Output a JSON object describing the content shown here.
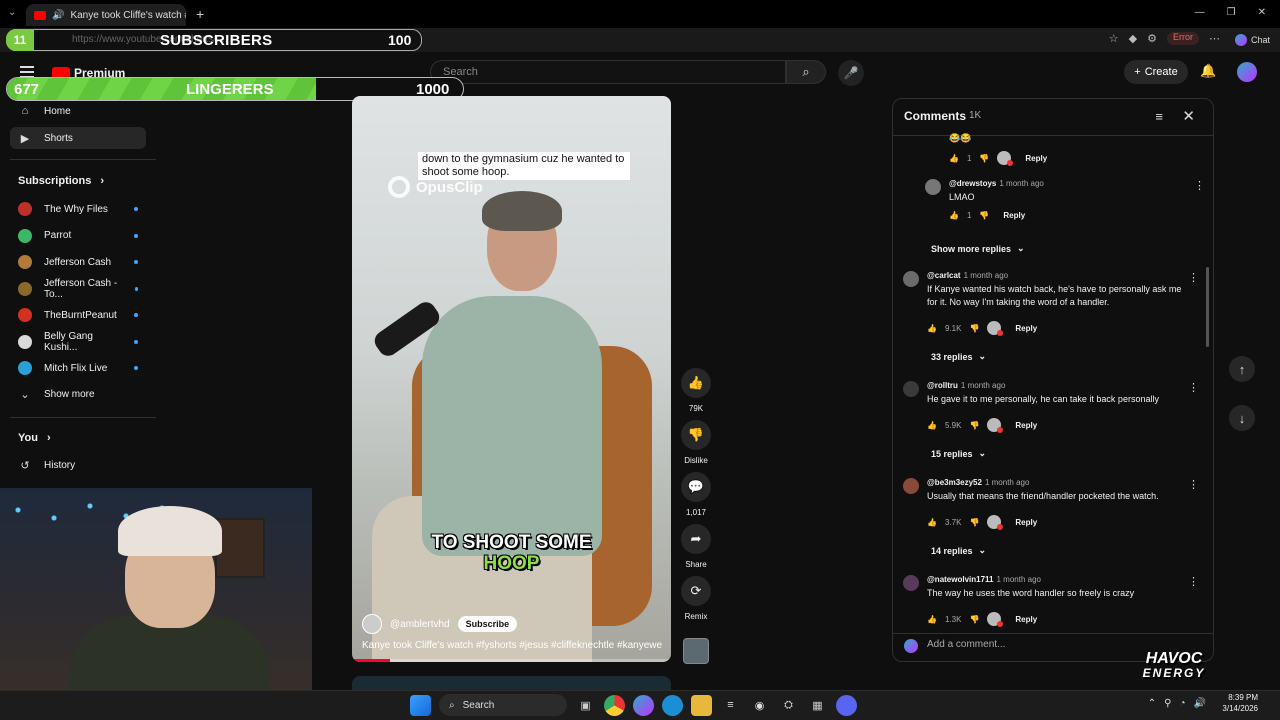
{
  "browser": {
    "tab_title": "Kanye took Cliffe's watch #fys",
    "new_tab_icon": "+",
    "url": "https://www.youtube.com/shorts/...",
    "error_label": "Error",
    "chat_label": "Chat"
  },
  "overlays": {
    "subscribers": {
      "count": "11",
      "label": "SUBSCRIBERS",
      "goal": "100",
      "progress": 0.11
    },
    "lingerers": {
      "count": "677",
      "label": "LINGERERS",
      "goal": "1000",
      "progress": 0.677
    }
  },
  "header": {
    "logo": "Premium",
    "search_placeholder": "Search",
    "create_label": "Create"
  },
  "sidebar": {
    "home": "Home",
    "shorts": "Shorts",
    "subscriptions_heading": "Subscriptions",
    "subscriptions": [
      {
        "name": "The Why Files",
        "color": "#c0302a"
      },
      {
        "name": "Parrot",
        "color": "#3ab86a"
      },
      {
        "name": "Jefferson Cash",
        "color": "#b07a3a"
      },
      {
        "name": "Jefferson Cash - To...",
        "color": "#8a6a2a"
      },
      {
        "name": "TheBurntPeanut",
        "color": "#d4301e"
      },
      {
        "name": "Belly Gang Kushi...",
        "color": "#d9d9d9"
      },
      {
        "name": "Mitch Flix Live",
        "color": "#2aa0d8"
      }
    ],
    "show_more": "Show more",
    "you_heading": "You",
    "history": "History"
  },
  "video": {
    "caption_top": "down to the gymnasium cuz he wanted to shoot some hoop.",
    "watermark": "OpusClip",
    "caption_big_line1": "TO SHOOT SOME",
    "caption_big_line2": "HOOP",
    "channel": "@amblertvhd",
    "subscribe": "Subscribe",
    "title": "Kanye took Cliffe's watch #fyshorts #jesus #cliffeknechtle #kanyewes...",
    "progress": 0.12
  },
  "actions": {
    "likes": "79K",
    "dislike": "Dislike",
    "comments": "1,017",
    "share": "Share",
    "remix": "Remix"
  },
  "comments": {
    "title": "Comments",
    "count": "1K",
    "show_more_replies": "Show more replies",
    "add_placeholder": "Add a comment...",
    "reply_label": "Reply",
    "top_reply": {
      "likes": "1"
    },
    "nested_reply": {
      "handle": "@drewstoys",
      "time": "1 month ago",
      "text": "LMAO",
      "likes": "1"
    },
    "items": [
      {
        "handle": "@carlcat",
        "time": "1 month ago",
        "text": "If Kanye wanted his watch back, he's have to personally ask me for it. No way I'm taking the word of a handler.",
        "likes": "9.1K",
        "replies": "33 replies",
        "color": "#6b6b6b"
      },
      {
        "handle": "@rolltru",
        "time": "1 month ago",
        "text": "He gave it to me personally, he can take it back personally",
        "likes": "5.9K",
        "replies": "15 replies",
        "color": "#3a3a3a"
      },
      {
        "handle": "@be3m3ezy52",
        "time": "1 month ago",
        "text": "Usually that means the friend/handler pocketed the watch.",
        "likes": "3.7K",
        "replies": "14 replies",
        "color": "#8a4a3a"
      },
      {
        "handle": "@natewolvin1711",
        "time": "1 month ago",
        "text": "The way he uses the word handler so freely is crazy",
        "likes": "1.3K",
        "replies": "",
        "color": "#5a3a5a"
      }
    ]
  },
  "branding": {
    "line1": "HAVOC",
    "line2": "ENERGY"
  },
  "taskbar": {
    "search": "Search",
    "time": "8:39 PM",
    "date": "3/14/2026"
  }
}
